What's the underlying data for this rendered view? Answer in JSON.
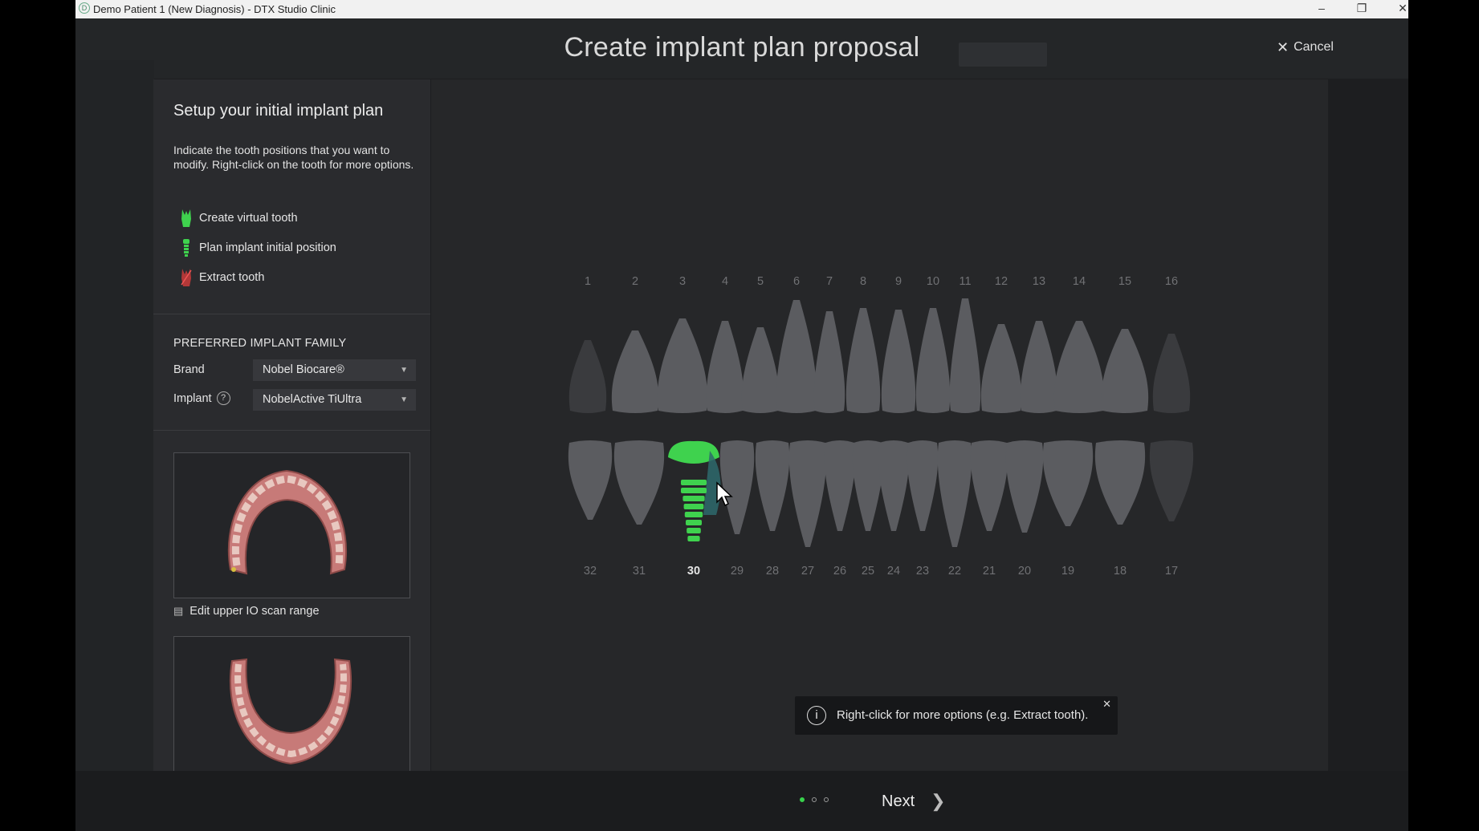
{
  "window": {
    "title": "Demo Patient 1 (New Diagnosis) - DTX Studio Clinic",
    "minimize_glyph": "–",
    "restore_glyph": "❐",
    "close_glyph": "✕"
  },
  "modal": {
    "title": "Create implant plan proposal",
    "cancel_label": "Cancel"
  },
  "setup": {
    "heading": "Setup your initial implant plan",
    "instructions": "Indicate the tooth positions that you want to modify. Right-click on the tooth for more options.",
    "legend": [
      {
        "label": "Create virtual tooth",
        "icon": "virtual-tooth-icon",
        "color": "#3fd24e"
      },
      {
        "label": "Plan implant initial position",
        "icon": "implant-icon",
        "color": "#3fd24e"
      },
      {
        "label": "Extract tooth",
        "icon": "extract-tooth-icon",
        "color": "#d23a3a"
      }
    ]
  },
  "implant_family": {
    "heading": "PREFERRED IMPLANT FAMILY",
    "brand_label": "Brand",
    "brand_value": "Nobel Biocare®",
    "implant_label": "Implant",
    "implant_value": "NobelActive TiUltra"
  },
  "scans": {
    "upper_label": "Edit upper IO scan range"
  },
  "tooth_chart": {
    "upper_numbers": [
      "1",
      "2",
      "3",
      "4",
      "5",
      "6",
      "7",
      "8",
      "9",
      "10",
      "11",
      "12",
      "13",
      "14",
      "15",
      "16"
    ],
    "lower_numbers": [
      "32",
      "31",
      "30",
      "29",
      "28",
      "27",
      "26",
      "25",
      "24",
      "23",
      "22",
      "21",
      "20",
      "19",
      "18",
      "17"
    ],
    "selected_tooth": "30",
    "selected_action": "implant",
    "implant_color": "#3fd24e",
    "tooth_color": "#5b5c60"
  },
  "tooltip": {
    "text": "Right-click for more options (e.g. Extract tooth)."
  },
  "pager": {
    "pages": 3,
    "current": 1,
    "next_label": "Next"
  }
}
